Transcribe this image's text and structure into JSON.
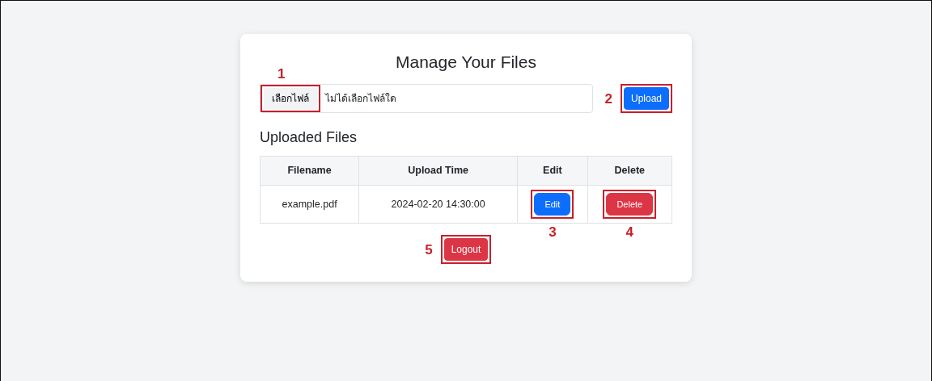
{
  "title": "Manage Your Files",
  "file_input": {
    "button": "เลือกไฟล์",
    "value": "ไม่ได้เลือกไฟล์ใด",
    "callout": "1"
  },
  "upload_button": {
    "label": "Upload",
    "callout": "2"
  },
  "section_title": "Uploaded Files",
  "table": {
    "columns": [
      "Filename",
      "Upload Time",
      "Edit",
      "Delete"
    ],
    "rows": [
      {
        "filename": "example.pdf",
        "upload_time": "2024-02-20 14:30:00",
        "edit": {
          "label": "Edit",
          "callout": "3"
        },
        "delete": {
          "label": "Delete",
          "callout": "4"
        }
      }
    ]
  },
  "logout_button": {
    "label": "Logout",
    "callout": "5"
  }
}
